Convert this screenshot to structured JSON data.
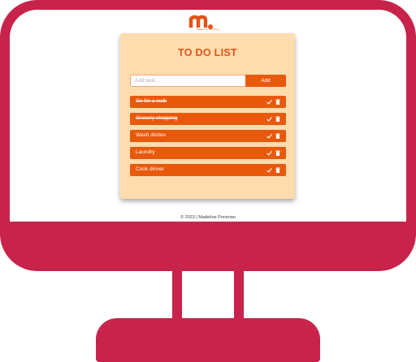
{
  "brand": {
    "logo_letter": "m",
    "tagline": "Madeline Poniman"
  },
  "todo": {
    "title": "TO DO LIST",
    "input": {
      "placeholder": "Add task",
      "value": ""
    },
    "add_label": "Add",
    "tasks": [
      {
        "text": "Go for a walk",
        "completed": true
      },
      {
        "text": "Grocery shopping",
        "completed": true
      },
      {
        "text": "Wash dishes",
        "completed": false
      },
      {
        "text": "Laundry",
        "completed": false
      },
      {
        "text": "Cook dinner",
        "completed": false
      }
    ]
  },
  "footer": {
    "text": "© 2023 | Madeline Poniman"
  },
  "icons": {
    "complete": "check-icon",
    "delete": "trash-icon"
  },
  "colors": {
    "monitor": "#c8234a",
    "accent": "#e8590c",
    "card_bg": "#ffdcae",
    "title": "#e2531a"
  }
}
